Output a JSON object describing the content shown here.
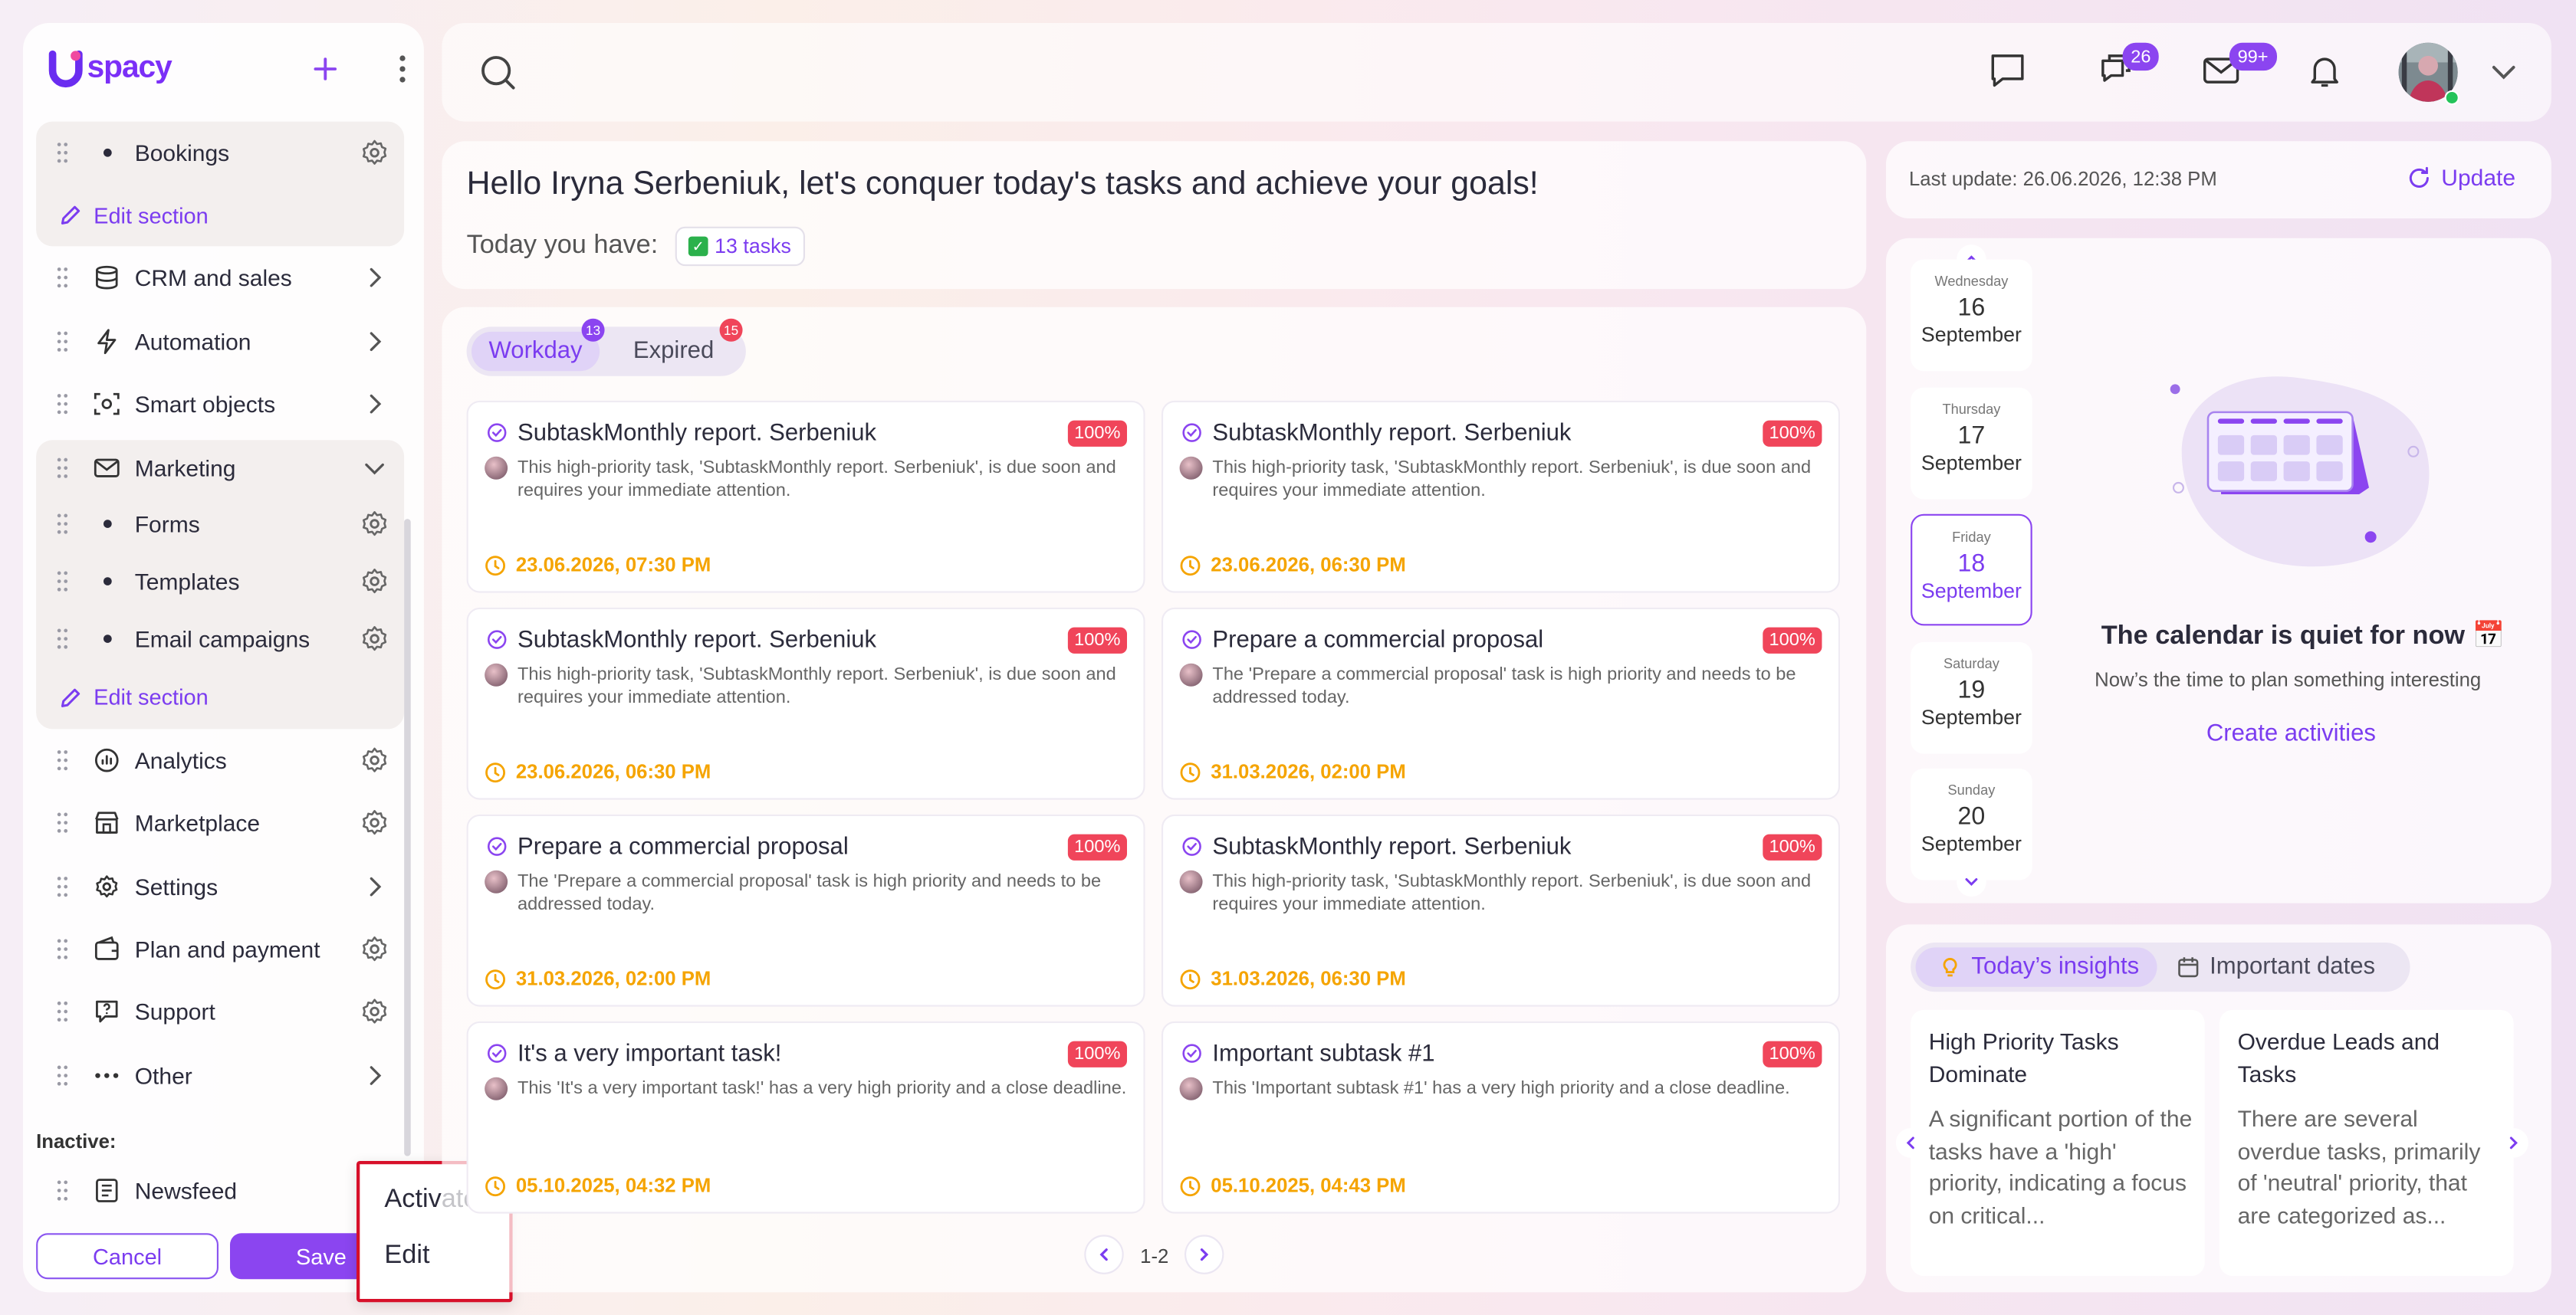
{
  "app": {
    "logo_text": "spacy"
  },
  "sidebar": {
    "items": [
      {
        "label": "Bookings"
      },
      {
        "label": "Edit section"
      },
      {
        "label": "CRM and sales"
      },
      {
        "label": "Automation"
      },
      {
        "label": "Smart objects"
      },
      {
        "label": "Marketing"
      },
      {
        "label": "Forms"
      },
      {
        "label": "Templates"
      },
      {
        "label": "Email campaigns"
      },
      {
        "label": "Edit section"
      },
      {
        "label": "Analytics"
      },
      {
        "label": "Marketplace"
      },
      {
        "label": "Settings"
      },
      {
        "label": "Plan and payment"
      },
      {
        "label": "Support"
      },
      {
        "label": "Other"
      }
    ],
    "inactive_label": "Inactive:",
    "inactive_items": [
      {
        "label": "Newsfeed"
      }
    ],
    "cancel_label": "Cancel",
    "save_label": "Save"
  },
  "context_menu": {
    "activate": "Activate",
    "edit": "Edit"
  },
  "topbar": {
    "chat_badge": "26",
    "mail_badge": "99+"
  },
  "greeting": {
    "title": "Hello Iryna Serbeniuk, let's conquer today's tasks and achieve your goals!",
    "today_label": "Today you have:",
    "tasks_chip": "13 tasks"
  },
  "tasks_panel": {
    "tabs": [
      {
        "label": "Workday",
        "count": "13"
      },
      {
        "label": "Expired",
        "count": "15"
      }
    ],
    "cards": [
      {
        "title": "SubtaskMonthly report. Serbeniuk",
        "pct": "100%",
        "desc": "This high-priority task, 'SubtaskMonthly report. Serbeniuk', is due soon and requires your immediate attention.",
        "date": "23.06.2026, 07:30 PM"
      },
      {
        "title": "SubtaskMonthly report. Serbeniuk",
        "pct": "100%",
        "desc": "This high-priority task, 'SubtaskMonthly report. Serbeniuk', is due soon and requires your immediate attention.",
        "date": "23.06.2026, 06:30 PM"
      },
      {
        "title": "SubtaskMonthly report. Serbeniuk",
        "pct": "100%",
        "desc": "This high-priority task, 'SubtaskMonthly report. Serbeniuk', is due soon and requires your immediate attention.",
        "date": "23.06.2026, 06:30 PM"
      },
      {
        "title": "Prepare a commercial proposal",
        "pct": "100%",
        "desc": "The 'Prepare a commercial proposal' task is high priority and needs to be addressed today.",
        "date": "31.03.2026, 02:00 PM"
      },
      {
        "title": "Prepare a commercial proposal",
        "pct": "100%",
        "desc": "The 'Prepare a commercial proposal' task is high priority and needs to be addressed today.",
        "date": "31.03.2026, 02:00 PM"
      },
      {
        "title": "SubtaskMonthly report. Serbeniuk",
        "pct": "100%",
        "desc": "This high-priority task, 'SubtaskMonthly report. Serbeniuk', is due soon and requires your immediate attention.",
        "date": "31.03.2026, 06:30 PM"
      },
      {
        "title": "It's a very important task!",
        "pct": "100%",
        "desc": "This 'It's a very important task!' has a very high priority and a close deadline.",
        "date": "05.10.2025, 04:32 PM"
      },
      {
        "title": "Important subtask #1",
        "pct": "100%",
        "desc": "This 'Important subtask #1' has a very high priority and a close deadline.",
        "date": "05.10.2025, 04:43 PM"
      }
    ],
    "pagination": "1-2"
  },
  "update": {
    "last_update": "Last update: 26.06.2026, 12:38 PM",
    "button": "Update"
  },
  "calendar": {
    "days": [
      {
        "weekday": "Wednesday",
        "day": "16",
        "month": "September"
      },
      {
        "weekday": "Thursday",
        "day": "17",
        "month": "September"
      },
      {
        "weekday": "Friday",
        "day": "18",
        "month": "September"
      },
      {
        "weekday": "Saturday",
        "day": "19",
        "month": "September"
      },
      {
        "weekday": "Sunday",
        "day": "20",
        "month": "September"
      }
    ],
    "empty_title": "The calendar is quiet for now 📅",
    "empty_sub": "Now’s the time to plan something interesting",
    "create_label": "Create activities"
  },
  "insights": {
    "tabs": [
      {
        "label": "Today’s insights"
      },
      {
        "label": "Important dates"
      }
    ],
    "cards": [
      {
        "title": "High Priority Tasks Dominate",
        "text": "A significant portion of the tasks have a 'high' priority, indicating a focus on critical..."
      },
      {
        "title": "Overdue Leads and Tasks",
        "text": "There are several overdue tasks, primarily of 'neutral' priority, that are categorized as..."
      }
    ]
  },
  "colors": {
    "accent": "#8b45f0",
    "danger": "#f0455a",
    "warning": "#f5a400",
    "success": "#24c35a"
  }
}
